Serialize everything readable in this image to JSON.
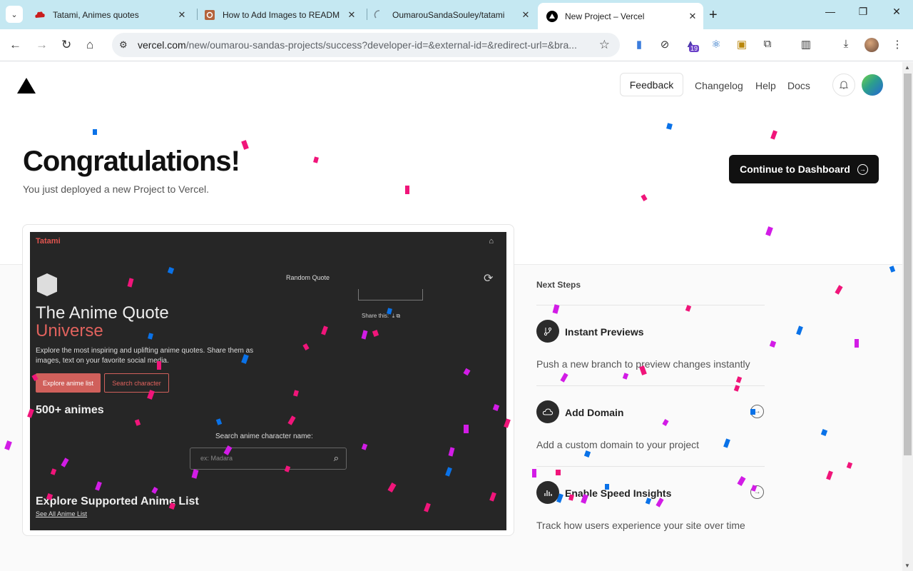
{
  "browser": {
    "tabs": [
      {
        "title": "Tatami, Animes quotes",
        "favicon": "red-cloud-icon",
        "active": false
      },
      {
        "title": "How to Add Images to READM",
        "favicon": "gear-book-icon",
        "active": false
      },
      {
        "title": "OumarouSandaSouley/tatami",
        "favicon": "loading-icon",
        "active": false
      },
      {
        "title": "New Project – Vercel",
        "favicon": "vercel-triangle-icon",
        "active": true
      }
    ],
    "url_host": "vercel.com",
    "url_path": "/new/oumarou-sandas-projects/success?developer-id=&external-id=&redirect-url=&bra...",
    "extension_badge": "19"
  },
  "header": {
    "feedback": "Feedback",
    "changelog": "Changelog",
    "help": "Help",
    "docs": "Docs"
  },
  "hero": {
    "title": "Congratulations!",
    "subtitle": "You just deployed a new Project to Vercel.",
    "cta": "Continue to Dashboard"
  },
  "preview": {
    "brand": "Tatami",
    "random_quote": "Random Quote",
    "share_this": "Share this:",
    "heading_line1": "The Anime Quote",
    "heading_line2": "Universe",
    "description": "Explore the most inspiring and uplifting anime quotes. Share them as images, text on your favorite social media.",
    "btn_explore": "Explore anime list",
    "btn_search": "Search character",
    "count": "500+ animes",
    "search_label": "Search anime character name:",
    "search_placeholder": "ex: Madara",
    "explore_title": "Explore Supported Anime List",
    "see_all": "See All Anime List"
  },
  "next_steps": {
    "title": "Next Steps",
    "items": [
      {
        "title": "Instant Previews",
        "desc": "Push a new branch to preview changes instantly",
        "icon": "git-branch-icon"
      },
      {
        "title": "Add Domain",
        "desc": "Add a custom domain to your project",
        "icon": "cloud-icon"
      },
      {
        "title": "Enable Speed Insights",
        "desc": "Track how users experience your site over time",
        "icon": "bar-chart-icon"
      }
    ]
  },
  "colors": {
    "tabbar": "#c5e8f2",
    "confetti_pink": "#f0157a",
    "confetti_magenta": "#d21ce6",
    "confetti_blue": "#0a72e8",
    "preview_accent": "#d0605b"
  }
}
